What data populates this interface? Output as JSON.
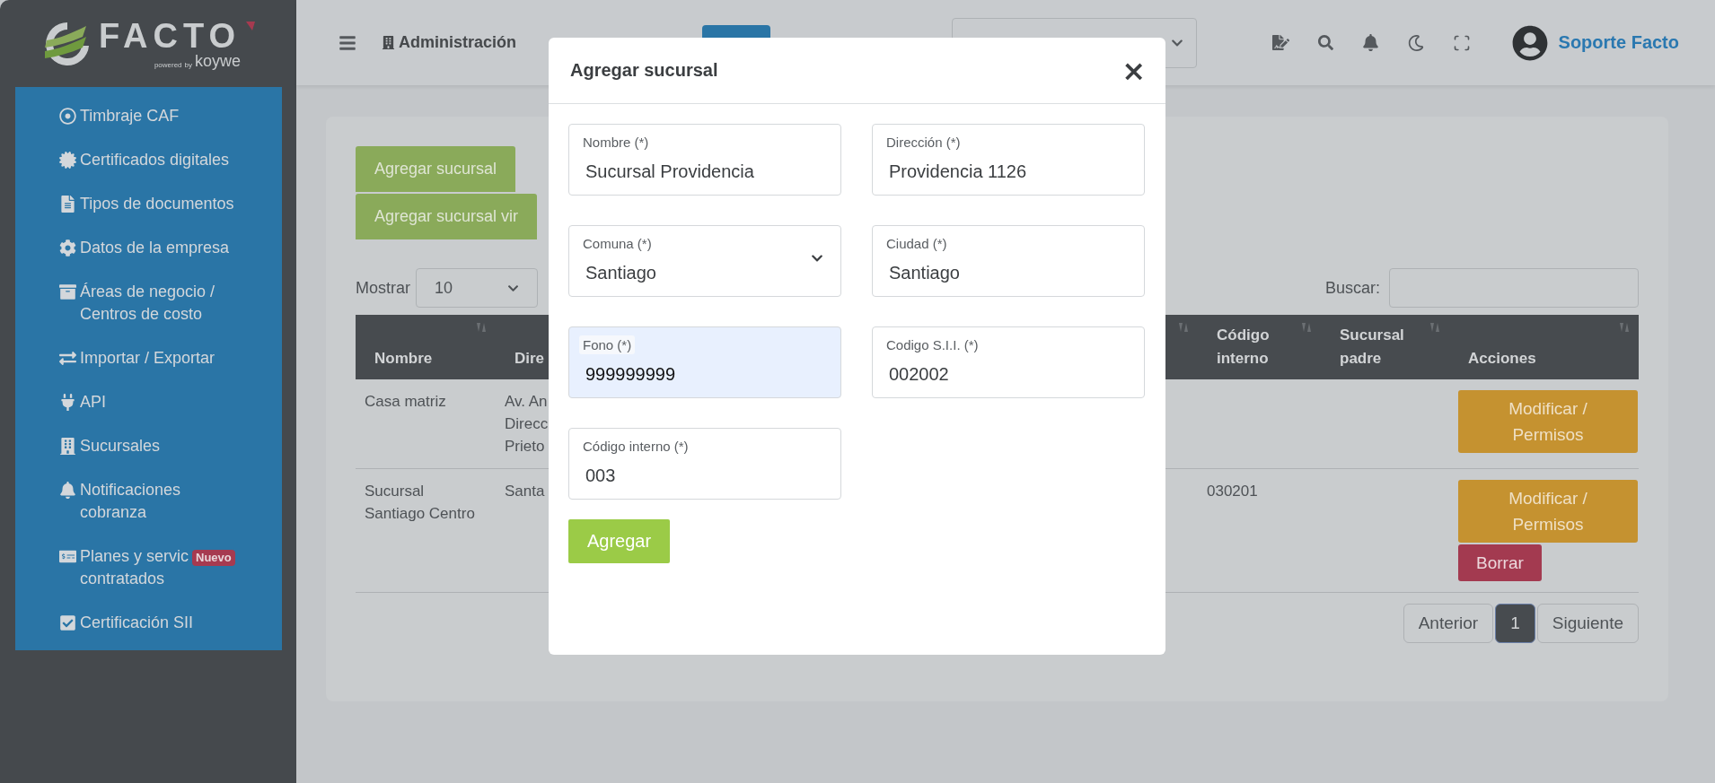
{
  "logo": {
    "wordmark": "FACTO",
    "powered": "powered",
    "by": "by",
    "brand": "koywe"
  },
  "sidebar": {
    "items": [
      {
        "lines": [
          "Timbraje CAF"
        ]
      },
      {
        "lines": [
          "Certificados digitales"
        ]
      },
      {
        "lines": [
          "Tipos de documentos"
        ]
      },
      {
        "lines": [
          "Datos de la empresa"
        ]
      },
      {
        "lines": [
          "Áreas de negocio /",
          "Centros de costo"
        ]
      },
      {
        "lines": [
          "Importar / Exportar"
        ]
      },
      {
        "lines": [
          "API"
        ]
      },
      {
        "lines": [
          "Sucursales"
        ]
      },
      {
        "lines": [
          "Notificaciones",
          "cobranza"
        ]
      },
      {
        "lines": [
          "Planes y servic",
          "contratados"
        ],
        "badge": "Nuevo"
      },
      {
        "lines": [
          "Certificación SII"
        ]
      }
    ]
  },
  "header": {
    "section": "Administración",
    "user": "Soporte Facto"
  },
  "content": {
    "buttons": [
      "Agregar sucursal",
      "Agregar sucursal vir"
    ],
    "show_label": "Mostrar",
    "page_size": "10",
    "search_label": "Buscar:",
    "table": {
      "columns": [
        "Nombre",
        "Dire",
        "Código interno",
        "Sucursal padre",
        "Acciones"
      ],
      "rows": [
        {
          "cells": [
            "Casa matriz",
            "Av. An\nDirecc\nPrieto",
            ""
          ],
          "actions": [
            {
              "kind": "modify",
              "label": "Modificar / Permisos"
            }
          ]
        },
        {
          "cells": [
            "Sucursal Santiago Centro",
            "Santa",
            "030201"
          ],
          "actions": [
            {
              "kind": "modify",
              "label": "Modificar / Permisos"
            },
            {
              "kind": "delete",
              "label": "Borrar"
            }
          ]
        }
      ]
    },
    "pagination": [
      {
        "label": "Anterior",
        "selected": false
      },
      {
        "label": "1",
        "selected": true
      },
      {
        "label": "Siguiente",
        "selected": false
      }
    ]
  },
  "modal": {
    "title": "Agregar sucursal",
    "close": "×",
    "fields": [
      {
        "kind": "text",
        "label": "Nombre (*)",
        "value": "Sucursal Providencia",
        "autofilled": false
      },
      {
        "kind": "text",
        "label": "Dirección (*)",
        "value": "Providencia 1126",
        "autofilled": false
      },
      {
        "kind": "select",
        "label": "Comuna (*)",
        "value": "Santiago",
        "autofilled": false
      },
      {
        "kind": "text",
        "label": "Ciudad (*)",
        "value": "Santiago",
        "autofilled": false
      },
      {
        "kind": "text",
        "label": "Fono (*)",
        "value": "999999999",
        "autofilled": true
      },
      {
        "kind": "text",
        "label": "Codigo S.I.I. (*)",
        "value": "002002",
        "autofilled": false
      },
      {
        "kind": "text",
        "label": "Código interno (*)",
        "value": "003",
        "autofilled": false
      }
    ],
    "submit": "Agregar"
  }
}
